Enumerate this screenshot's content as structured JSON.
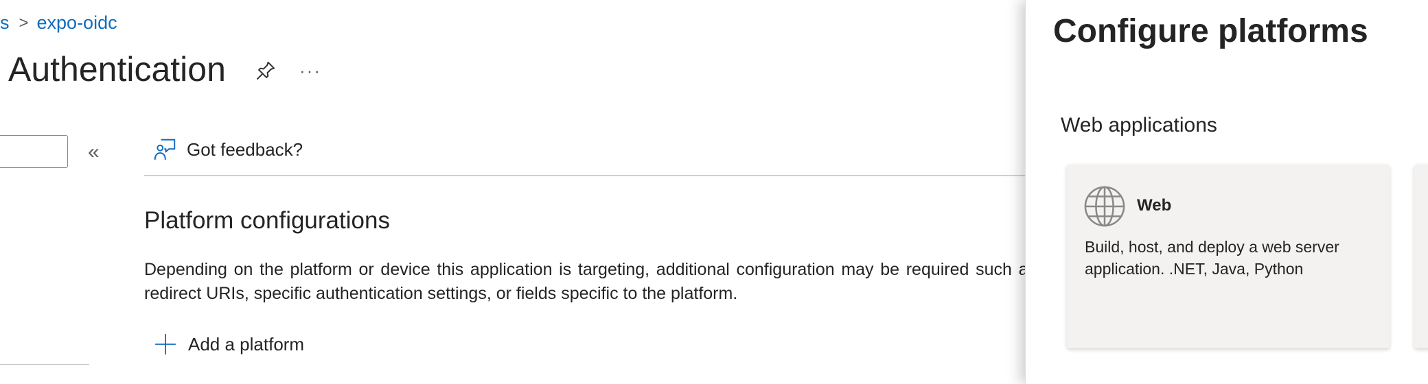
{
  "breadcrumb": {
    "parent_label": "s",
    "separator": ">",
    "current_label": "expo-oidc"
  },
  "page": {
    "title": "Authentication",
    "more_label": "···"
  },
  "command_bar": {
    "feedback_label": "Got feedback?",
    "collapse_label": "«"
  },
  "main": {
    "section_heading": "Platform configurations",
    "description": "Depending on the platform or device this application is targeting, additional configuration may be required such as redirect URIs, specific authentication settings, or fields specific to the platform.",
    "add_platform_label": "Add a platform"
  },
  "panel": {
    "title": "Configure platforms",
    "section_heading": "Web applications",
    "tiles": [
      {
        "icon": "globe-icon",
        "title": "Web",
        "description": "Build, host, and deploy a web server application. .NET, Java, Python"
      }
    ]
  },
  "colors": {
    "link": "#0f6cbd",
    "text": "#242424",
    "tile_bg": "#f3f2f1",
    "divider": "#d2d0ce"
  }
}
